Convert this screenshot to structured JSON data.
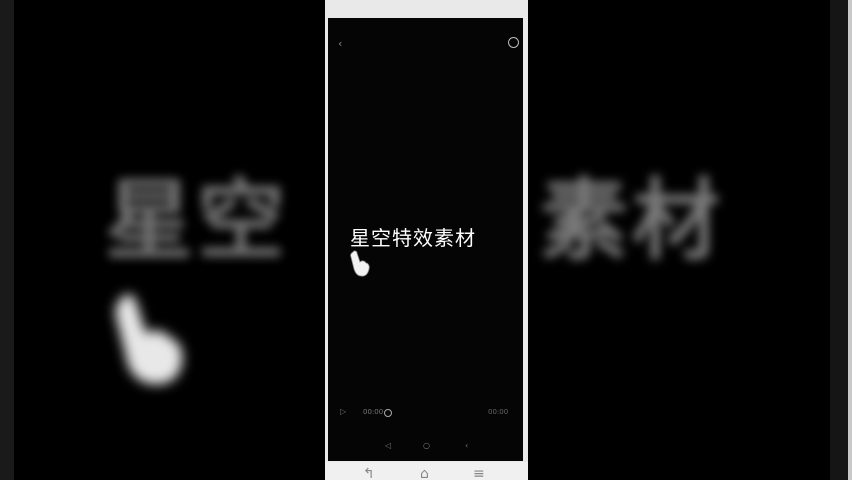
{
  "video": {
    "title_text": "星空特效素材",
    "bg_left_text": "星空",
    "bg_right_text": "素材"
  },
  "app_nav": {
    "back_glyph": "‹"
  },
  "player": {
    "play_glyph": "▷",
    "time_text": "00:00",
    "end_text": "00:00"
  },
  "system_nav": {
    "back": "◁",
    "home": "○",
    "recent": "‹"
  },
  "bottom_bar": {
    "back": "↰",
    "home": "⌂",
    "menu": "≡"
  }
}
